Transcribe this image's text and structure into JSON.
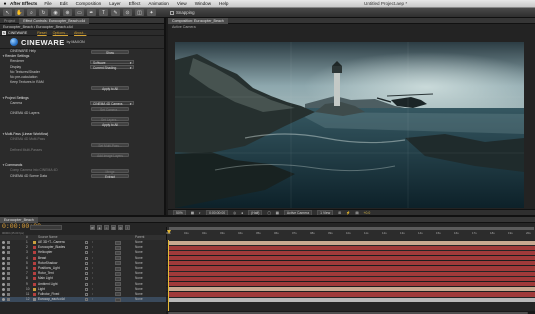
{
  "menubar": {
    "app": "After Effects",
    "items": [
      "File",
      "Edit",
      "Composition",
      "Layer",
      "Effect",
      "Animation",
      "View",
      "Window",
      "Help"
    ],
    "document": "Untitled Project.aep *"
  },
  "toolbar": {
    "snapping_label": "Snapping"
  },
  "left_panel": {
    "tabs": [
      "Project",
      "Effect Controls: Eurocopter_Beach.c4d"
    ],
    "path": "Eurocopter_Beach • Eurocopter_Beach.c4d",
    "effect_name": "CINEWARE",
    "reset_label": "Reset",
    "options_label": "Options...",
    "about_label": "About...",
    "brand": "CINEWARE",
    "brand_maker": "by MAXON",
    "rows": {
      "help": "CINEWARE Help",
      "render_settings": "Render Settings",
      "renderer": "Renderer",
      "renderer_value": "Software",
      "display": "Display",
      "display_value": "Current Shading",
      "no_textures": "No Textures/Shader",
      "no_precalc": "No pre-calculation",
      "keep_textures": "Keep Textures in RAM",
      "project_settings": "Project Settings",
      "camera": "Camera",
      "camera_value": "CINEMA 4D Camera",
      "c4d_layers": "CINEMA 4D Layers",
      "multipass": "Multi-Pass (Linear Workflow)",
      "c4d_multipass": "CINEMA 4D Multi-Pass",
      "defined_multipasses": "Defined Multi-Passes",
      "commands": "Commands",
      "comp_camera": "Comp Camera into CINEMA 4D",
      "scene_data": "CINEMA 4D Scene Data",
      "show_label": "Show",
      "apply_all_label": "Apply to All",
      "set_camera_label": "Set Camera...",
      "set_layers_label": "Set Layers...",
      "set_multipass_label": "Set Multi-Pass...",
      "add_image_layers_label": "Add Image Layers",
      "merge_label": "Merge",
      "extract_label": "Extract"
    }
  },
  "viewer": {
    "tab": "Composition: Eurocopter_Beach",
    "active_camera": "Active Camera",
    "zoom": "50%",
    "timecode": "0:00:00:00",
    "resolution": "(Half)",
    "camera": "Active Camera",
    "view_count": "1 View",
    "exposure": "+0.0"
  },
  "timeline": {
    "tab": "Eurocopter_Beach",
    "timecode": "0:00:00:00",
    "fps_info": "00000 (25.00 fps)",
    "columns": {
      "number": "#",
      "source_name": "Source Name",
      "parent": "Parent"
    },
    "ticks": [
      "00s",
      "01s",
      "02s",
      "03s",
      "04s",
      "05s",
      "06s",
      "07s",
      "08s",
      "09s",
      "10s",
      "11s",
      "12s",
      "13s",
      "14s",
      "15s",
      "16s",
      "17s",
      "18s",
      "19s",
      "20s"
    ],
    "layers": [
      {
        "num": "1",
        "name": "AE 3D+T...Camera",
        "parent": "None",
        "label_color": "#c8a13e",
        "bar_color": "#c8a890"
      },
      {
        "num": "2",
        "name": "Eurocopter_Blades",
        "parent": "None",
        "label_color": "#b54040",
        "bar_color": "#a03a3a"
      },
      {
        "num": "3",
        "name": "Helicopter",
        "parent": "None",
        "label_color": "#b54040",
        "bar_color": "#a03a3a"
      },
      {
        "num": "4",
        "name": "Beast",
        "parent": "None",
        "label_color": "#b54040",
        "bar_color": "#a03a3a"
      },
      {
        "num": "5",
        "name": "RotorShadow",
        "parent": "None",
        "label_color": "#b54040",
        "bar_color": "#a03a3a"
      },
      {
        "num": "6",
        "name": "Positions_Light",
        "parent": "None",
        "label_color": "#b54040",
        "bar_color": "#a03a3a"
      },
      {
        "num": "7",
        "name": "Rotor_Tent",
        "parent": "None",
        "label_color": "#b54040",
        "bar_color": "#a03a3a"
      },
      {
        "num": "8",
        "name": "Main Light",
        "parent": "None",
        "label_color": "#b54040",
        "bar_color": "#a03a3a"
      },
      {
        "num": "9",
        "name": "Ambient Light",
        "parent": "None",
        "label_color": "#b54040",
        "bar_color": "#a03a3a"
      },
      {
        "num": "10",
        "name": "Light",
        "parent": "None",
        "label_color": "#c8a13e",
        "bar_color": "#c8a890"
      },
      {
        "num": "11",
        "name": "Fullrotor_Fixed",
        "parent": "None",
        "label_color": "#b54040",
        "bar_color": "#a03a3a"
      },
      {
        "num": "12",
        "name": "Eurocop_each.c4d",
        "parent": "None",
        "label_color": "#8a8a8a",
        "bar_color": "#b9b9b9"
      }
    ]
  }
}
